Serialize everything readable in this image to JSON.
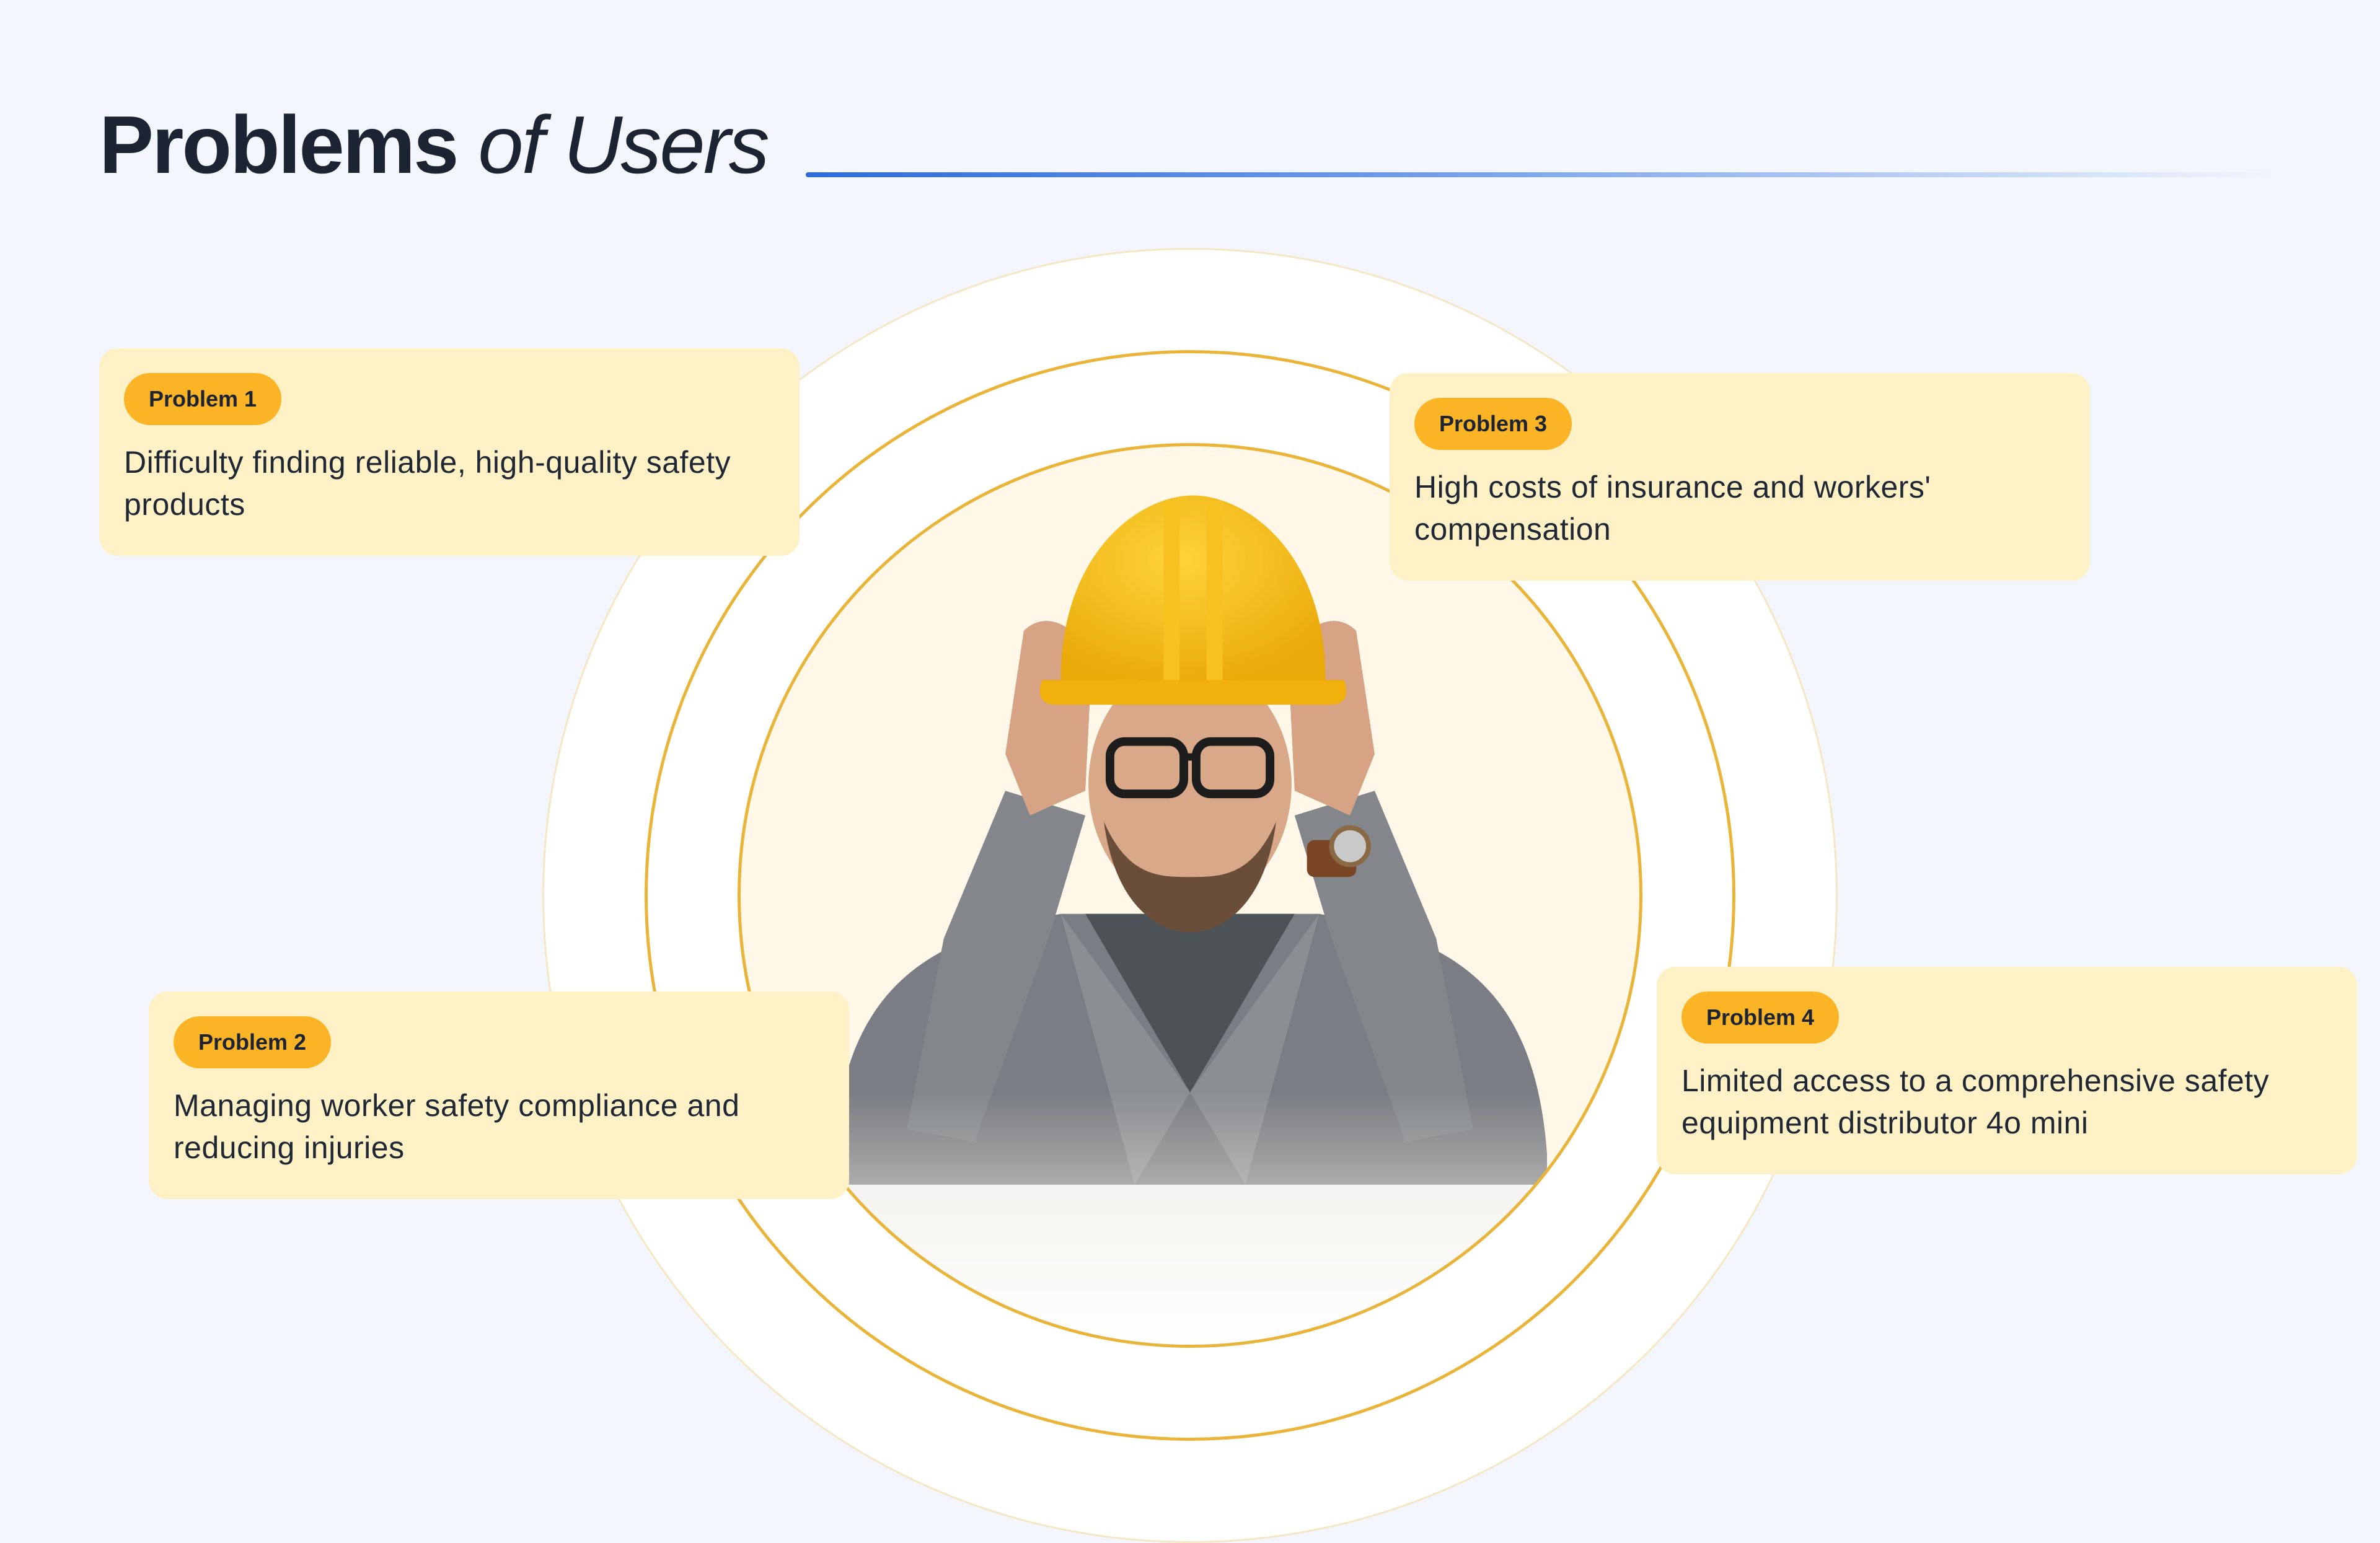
{
  "slide": {
    "title_bold": "Problems",
    "title_rest": "of Users"
  },
  "problems": [
    {
      "badge": "Problem 1",
      "text": "Difficulty finding reliable, high-quality safety products"
    },
    {
      "badge": "Problem 2",
      "text": "Managing worker safety compliance and reducing injuries"
    },
    {
      "badge": "Problem 3",
      "text": "High costs of insurance and workers' compensation"
    },
    {
      "badge": "Problem 4",
      "text": "Limited access to a comprehensive safety equipment distributor 4o mini"
    }
  ],
  "colors": {
    "background": "#f3f7fd",
    "accent_blue": "#2f6bd8",
    "badge_yellow": "#fbb425",
    "card_yellow": "#fff1c6",
    "ring_gold": "#e9b437"
  }
}
